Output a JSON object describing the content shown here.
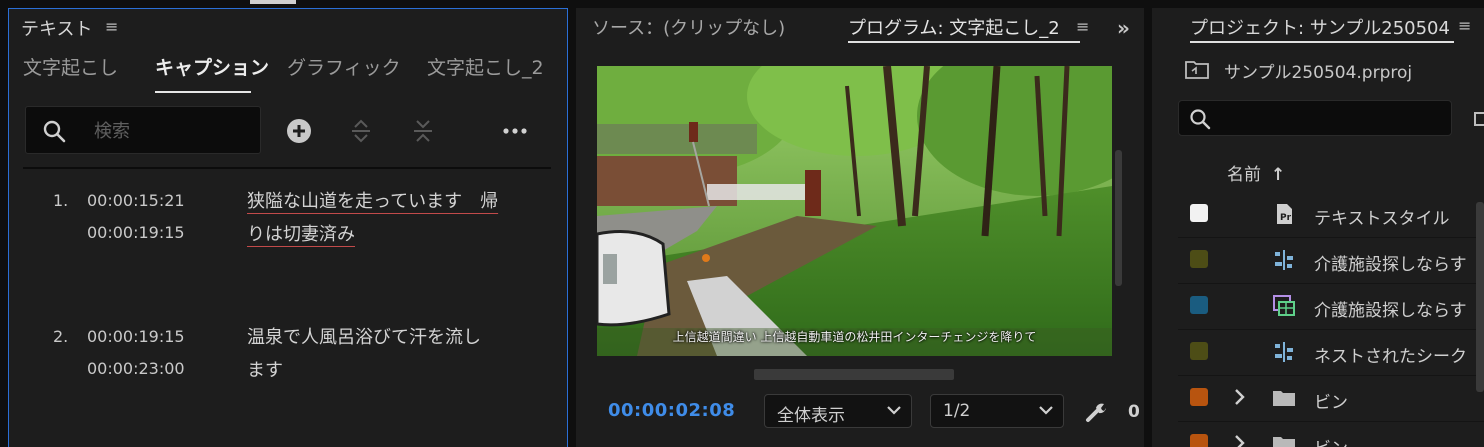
{
  "text_panel": {
    "title": "テキスト",
    "menu_glyph": "≡",
    "tabs": [
      {
        "label": "文字起こし",
        "active": false
      },
      {
        "label": "キャプション",
        "active": true
      },
      {
        "label": "グラフィック",
        "active": false
      },
      {
        "label": "文字起こし_2",
        "active": false
      }
    ],
    "search_placeholder": "検索",
    "toolbar_icons": [
      "add-icon",
      "expand-all-icon",
      "collapse-all-icon",
      "more-icon"
    ],
    "captions": [
      {
        "num": "1.",
        "in": "00:00:15:21",
        "out": "00:00:19:15",
        "line1": "狭隘な山道を走っています　帰",
        "line2": "りは切妻済み",
        "spellcheck_underline": true
      },
      {
        "num": "2.",
        "in": "00:00:19:15",
        "out": "00:00:23:00",
        "line1": "温泉で人風呂浴びて汗を流し",
        "line2": "ます",
        "spellcheck_underline": false
      }
    ]
  },
  "monitor_panel": {
    "source_title": "ソース：(クリップなし)",
    "program_title": "プログラム: 文字起こし_2",
    "menu_glyph": "≡",
    "expand_glyph": "»",
    "subtitle_overlay": "上信越道間違い 上信越自動車道の松井田インターチェンジを降りて",
    "timecode": "00:00:02:08",
    "zoom_value": "全体表示",
    "resolution_value": "1/2",
    "cut_text": "0"
  },
  "project_panel": {
    "title": "プロジェクト: サンプル250504",
    "menu_glyph": "≡",
    "file_name": "サンプル250504.prproj",
    "column_name": "名前",
    "sort_arrow": "↑",
    "items": [
      {
        "label": "テキストスタイル",
        "icon": "text-style-icon",
        "color": "#f2f2f2",
        "chevron": false
      },
      {
        "label": "介護施設探しならす",
        "icon": "sequence-icon",
        "color": "#4d4d16",
        "chevron": false
      },
      {
        "label": "介護施設探しならす",
        "icon": "multicam-clip-icon",
        "color": "#1a5c80",
        "chevron": false
      },
      {
        "label": "ネストされたシーク",
        "icon": "sequence-icon",
        "color": "#4d4d16",
        "chevron": false
      },
      {
        "label": "ビン",
        "icon": "folder-icon",
        "color": "#b8540f",
        "chevron": true
      },
      {
        "label": "ビン",
        "icon": "folder-icon",
        "color": "#b8540f",
        "chevron": true
      }
    ]
  },
  "colors": {
    "accent_blue": "#3f8ce8",
    "panel_bg": "#1d1d1d",
    "focus_border": "#2b6fd6",
    "spellcheck_red": "#c24a4a"
  }
}
